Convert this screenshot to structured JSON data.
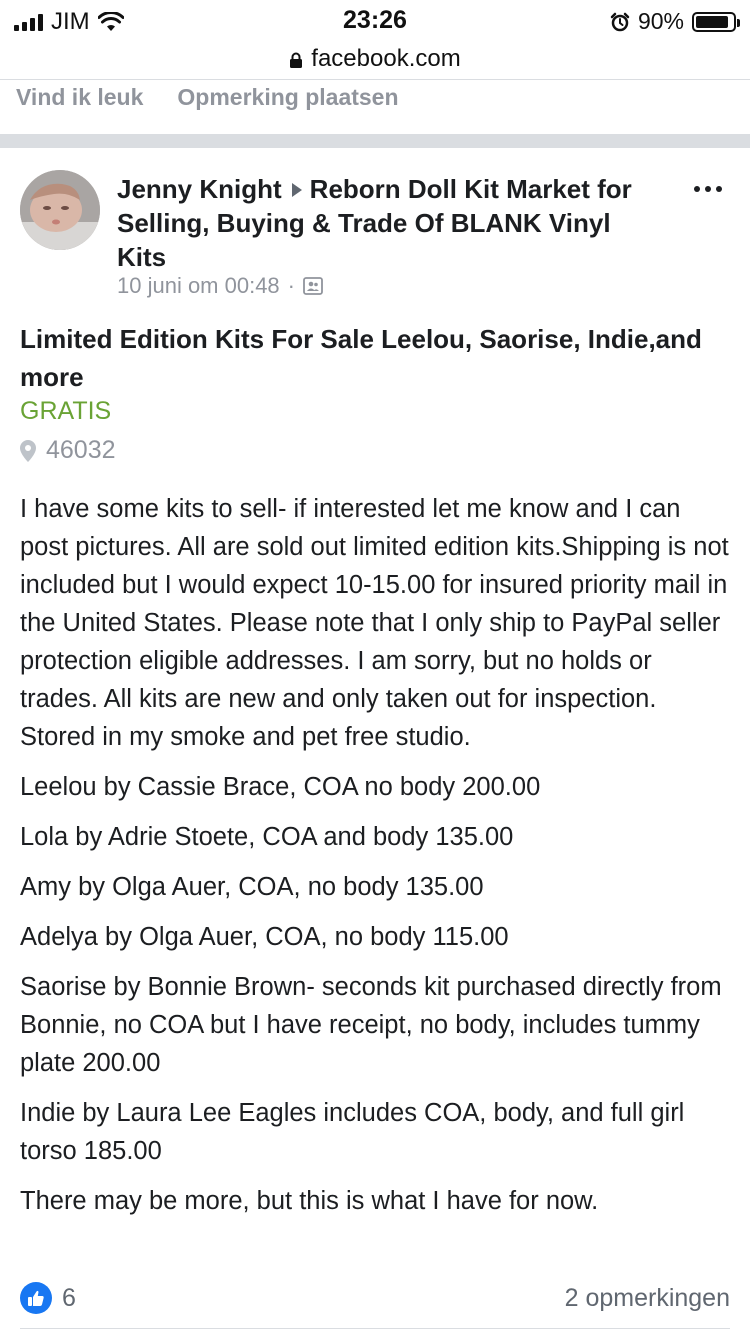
{
  "status_bar": {
    "carrier": "JIM",
    "time": "23:26",
    "battery_percent": "90%",
    "battery_level": 0.9,
    "icons": [
      "signal-icon",
      "wifi-icon",
      "alarm-icon",
      "battery-icon"
    ]
  },
  "browser": {
    "url": "facebook.com"
  },
  "previous_post_actions": {
    "like": "Vind ik leuk",
    "comment": "Opmerking plaatsen"
  },
  "post": {
    "author": "Jenny Knight",
    "group": "Reborn Doll Kit Market for Selling, Buying & Trade Of BLANK Vinyl Kits",
    "timestamp": "10 juni om 00:48",
    "separator_dot": "·",
    "title": "Limited Edition Kits For Sale Leelou, Saorise, Indie,and more",
    "price": "GRATIS",
    "location": "46032",
    "paragraphs": [
      "I have some kits to sell- if interested let me know and I can post pictures. All are sold out limited edition kits.Shipping is not included but I would expect 10-15.00 for insured priority mail in the United States. Please note that I only ship to PayPal seller protection eligible addresses. I am sorry, but no holds or trades. All kits are new and only taken out for inspection. Stored in my smoke and pet free studio.",
      "Leelou by Cassie Brace, COA no body 200.00",
      "Lola by Adrie Stoete, COA and body 135.00",
      "Amy by Olga Auer, COA, no body 135.00",
      "Adelya by Olga Auer, COA, no body 115.00",
      "Saorise by Bonnie Brown- seconds kit purchased directly from Bonnie, no COA but I have receipt, no body, includes tummy plate 200.00",
      "Indie by Laura Lee Eagles includes COA, body, and full girl torso 185.00",
      "There may be more, but this is what I have for now."
    ],
    "like_count": "6",
    "comment_count": "2 opmerkingen"
  },
  "colors": {
    "price_green": "#6aa335",
    "meta_gray": "#90949c",
    "like_blue": "#1877f2",
    "separator_gray": "#dadde1"
  }
}
